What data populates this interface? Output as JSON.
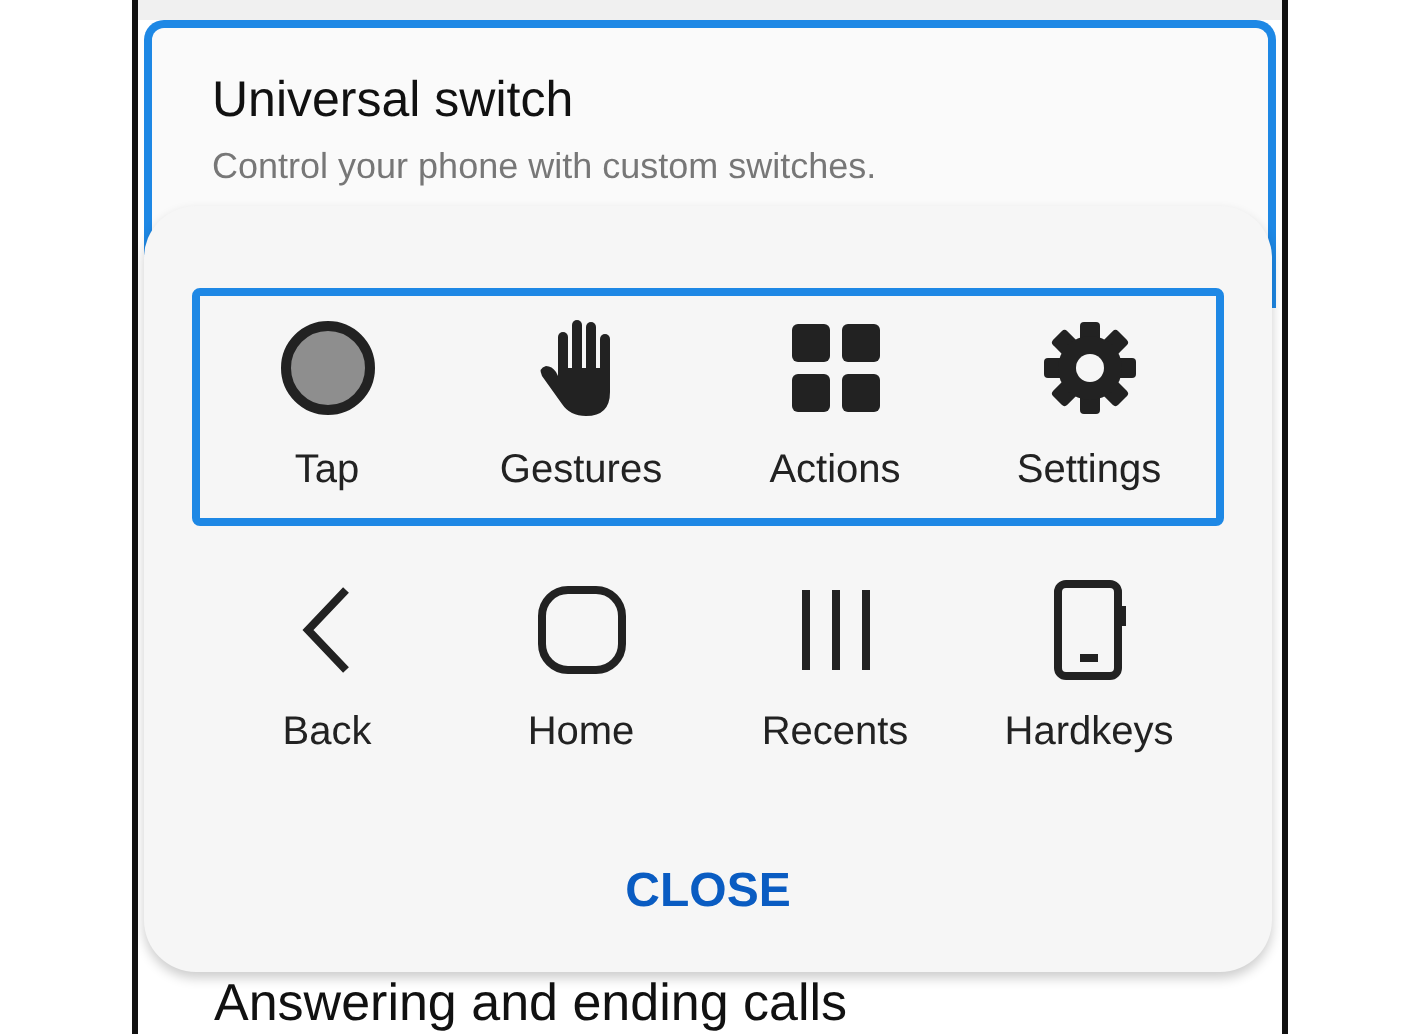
{
  "card": {
    "title": "Universal switch",
    "subtitle": "Control your phone with custom switches.",
    "highlighted": true
  },
  "panel": {
    "groups": [
      {
        "highlighted": true,
        "items": [
          {
            "label": "Tap",
            "kind": "tap"
          },
          {
            "label": "Gestures",
            "kind": "hand"
          },
          {
            "label": "Actions",
            "kind": "grid"
          },
          {
            "label": "Settings",
            "kind": "gear"
          }
        ]
      },
      {
        "highlighted": false,
        "items": [
          {
            "label": "Back",
            "kind": "back"
          },
          {
            "label": "Home",
            "kind": "home"
          },
          {
            "label": "Recents",
            "kind": "recents"
          },
          {
            "label": "Hardkeys",
            "kind": "device"
          }
        ]
      }
    ],
    "close": "CLOSE"
  },
  "background_item": {
    "title": "Answering and ending calls"
  }
}
